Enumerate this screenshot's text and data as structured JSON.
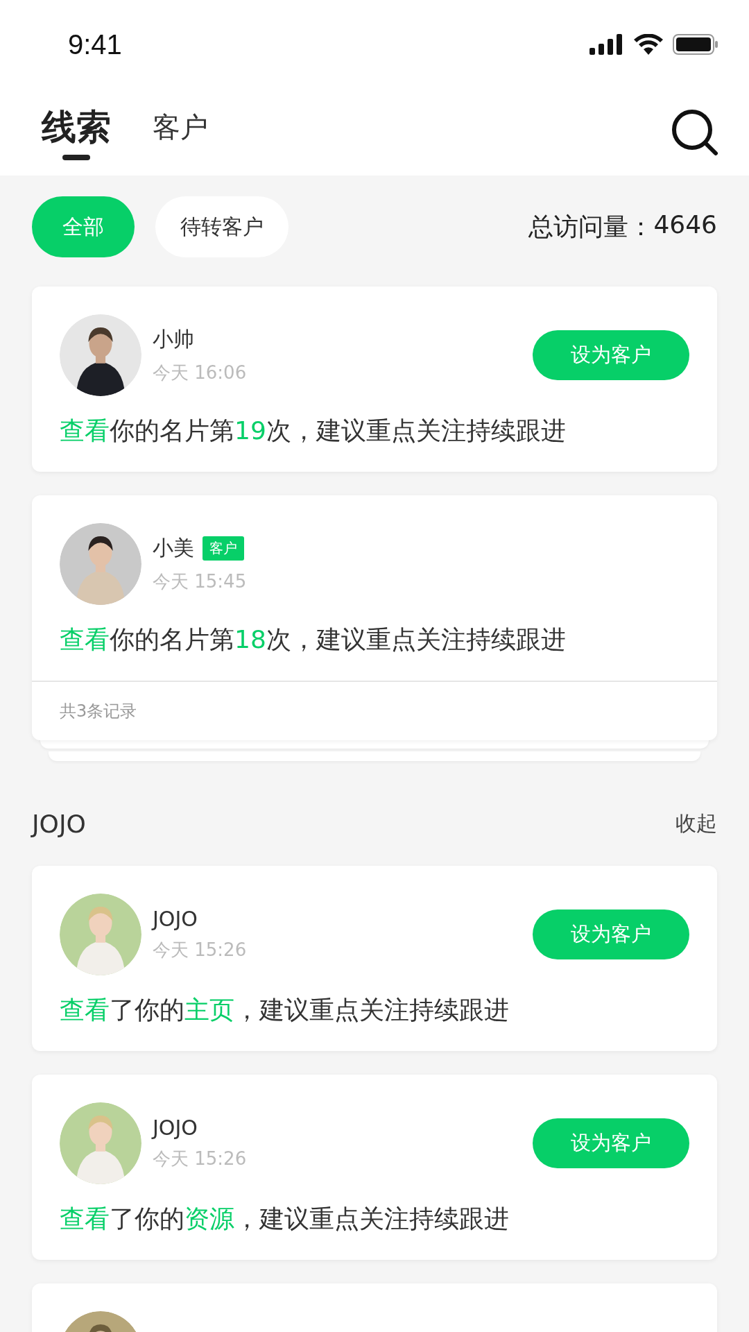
{
  "status_bar": {
    "time": "9:41"
  },
  "tabs": [
    {
      "label": "线索",
      "selected": true
    },
    {
      "label": "客户",
      "selected": false
    }
  ],
  "filters": [
    {
      "label": "全部",
      "selected": true
    },
    {
      "label": "待转客户",
      "selected": false
    }
  ],
  "total_visits": {
    "label": "总访问量：",
    "value": "4646"
  },
  "groups": [
    {
      "cards": [
        {
          "kind": "lead",
          "name": "小帅",
          "time": "今天 16:06",
          "button": "设为客户",
          "message": [
            {
              "text": "查看",
              "highlight": true
            },
            {
              "text": "你的名片第",
              "highlight": false
            },
            {
              "text": "19",
              "highlight": true
            },
            {
              "text": "次，建议重点关注持续跟进",
              "highlight": false
            }
          ]
        },
        {
          "kind": "lead",
          "name": "小美",
          "tag": "客户",
          "time": "今天 15:45",
          "message": [
            {
              "text": "查看",
              "highlight": true
            },
            {
              "text": "你的名片第",
              "highlight": false
            },
            {
              "text": "18",
              "highlight": true
            },
            {
              "text": "次，建议重点关注持续跟进",
              "highlight": false
            }
          ],
          "footer": "共3条记录"
        }
      ]
    },
    {
      "title": "JOJO",
      "action": "收起",
      "cards": [
        {
          "kind": "lead",
          "name": "JOJO",
          "time": "今天 15:26",
          "button": "设为客户",
          "message": [
            {
              "text": "查看",
              "highlight": true
            },
            {
              "text": "了你的",
              "highlight": false
            },
            {
              "text": "主页",
              "highlight": true
            },
            {
              "text": "，建议重点关注持续跟进",
              "highlight": false
            }
          ]
        },
        {
          "kind": "lead",
          "name": "JOJO",
          "time": "今天 15:26",
          "button": "设为客户",
          "message": [
            {
              "text": "查看",
              "highlight": true
            },
            {
              "text": "了你的",
              "highlight": false
            },
            {
              "text": "资源",
              "highlight": true
            },
            {
              "text": "，建议重点关注持续跟进",
              "highlight": false
            }
          ]
        },
        {
          "kind": "partial"
        }
      ]
    }
  ]
}
